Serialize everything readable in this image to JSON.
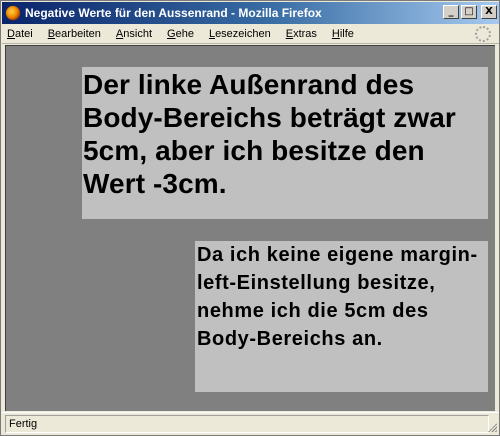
{
  "window": {
    "title": "Negative Werte für den Aussenrand - Mozilla Firefox",
    "controls": {
      "minimize": "_",
      "maximize": "□",
      "close": "X"
    }
  },
  "menu": {
    "items": [
      "Datei",
      "Bearbeiten",
      "Ansicht",
      "Gehe",
      "Lesezeichen",
      "Extras",
      "Hilfe"
    ]
  },
  "content": {
    "box1_text": "Der linke Außenrand des Body-Bereichs beträgt zwar 5cm, aber ich besitze den Wert -3cm.",
    "box2_text": "Da ich keine eigene margin-left-Einstellung besitze, nehme ich die 5cm des Body-Bereichs an."
  },
  "status": {
    "text": "Fertig"
  },
  "icons": {
    "app": "firefox-logo-icon",
    "throbber": "throbber-icon",
    "grip": "resize-grip-icon"
  }
}
